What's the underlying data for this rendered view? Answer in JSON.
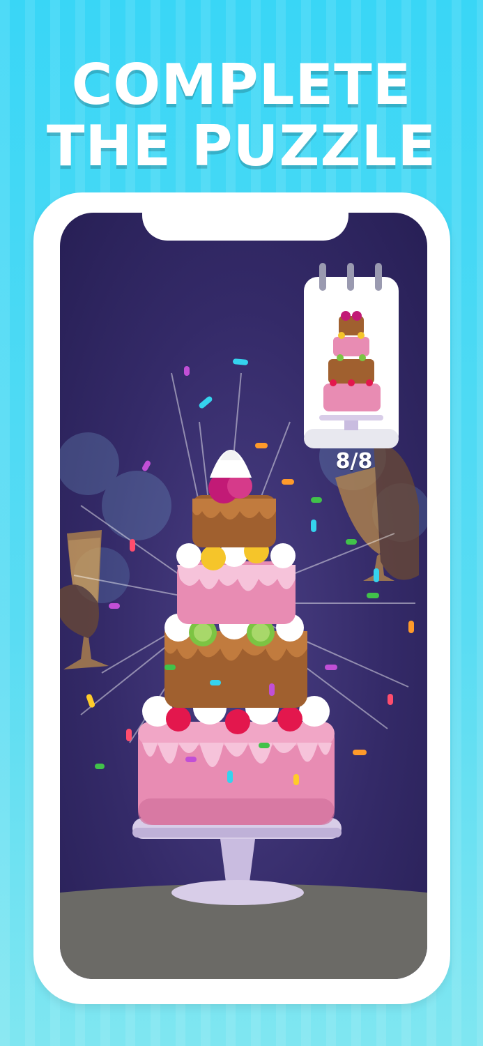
{
  "headline": {
    "line1": "COMPLETE",
    "line2": "THE PUZZLE"
  },
  "game": {
    "progress_text": "8/8",
    "progress_value": 1.0
  },
  "colors": {
    "background": "#39d6f6",
    "screen_bg": "#342a68",
    "cake_pink": "#e88cb3",
    "cake_brown": "#a0602f",
    "stand": "#d8cde8",
    "table": "#6b6a66"
  },
  "icons": {
    "recipe_card": "spiral-notebook-icon",
    "champagne": "champagne-glass-icon"
  }
}
